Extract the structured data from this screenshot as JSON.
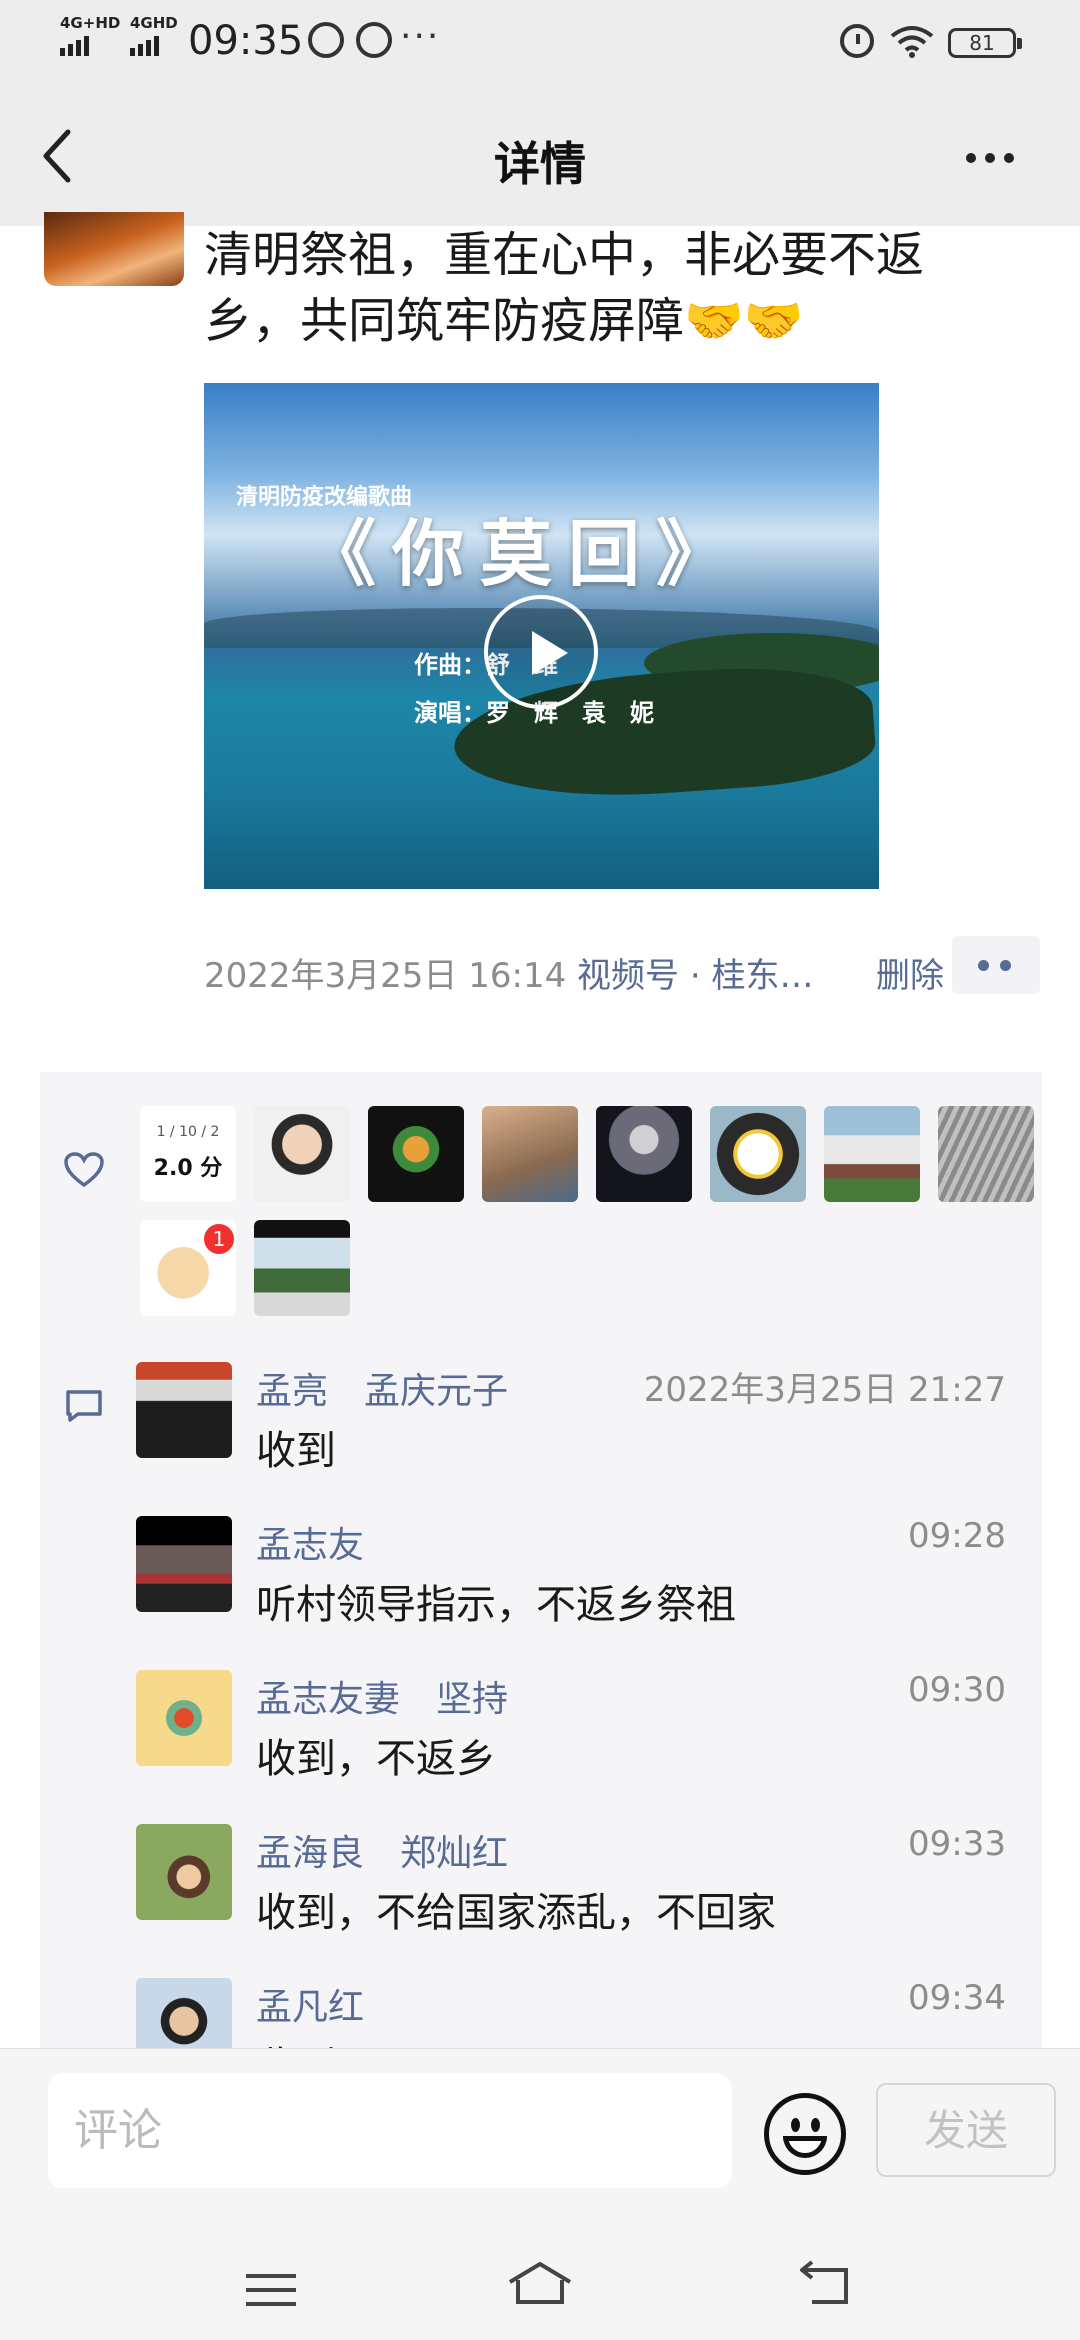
{
  "status_bar": {
    "network_1": "4G+HD",
    "network_2": "4GHD",
    "time": "09:35",
    "more": "···",
    "battery": "81"
  },
  "header": {
    "title": "详情"
  },
  "post": {
    "text": "清明祭祖，重在心中，非必要不返乡，共同筑牢防疫屏障🤝🤝",
    "video": {
      "subtitle": "清明防疫改编歌曲",
      "title": "《你莫回》",
      "credit_composer": "作曲：舒　维",
      "credit_singers": "演唱：罗　辉　袁　妮"
    },
    "date_time": "2022年3月25日 16:14",
    "source": "视频号 · 桂东…",
    "delete_label": "删除"
  },
  "likes": {
    "score_badge_line1": "1 / 10 / 2",
    "score_badge_line2": "2.0 分",
    "notification_count": "1"
  },
  "comments": [
    {
      "names": "孟亮　孟庆元子",
      "time": "2022年3月25日 21:27",
      "text": "收到"
    },
    {
      "names": "孟志友",
      "time": "09:28",
      "text": "听村领导指示，不返乡祭祖"
    },
    {
      "names": "孟志友妻　坚持",
      "time": "09:30",
      "text": "收到，不返乡"
    },
    {
      "names": "孟海良　郑灿红",
      "time": "09:33",
      "text": "收到，不给国家添乱，不回家"
    },
    {
      "names": "孟凡红",
      "time": "09:34",
      "text": "收到"
    }
  ],
  "input": {
    "placeholder": "评论",
    "send_label": "发送"
  },
  "colors": {
    "link_blue": "#576b95",
    "header_bg": "#ededed",
    "panel_bg": "#f5f5f7",
    "badge_red": "#f23030"
  },
  "icons": [
    "back-icon",
    "more-icon",
    "play-icon",
    "heart-icon",
    "comment-icon",
    "emoji-icon",
    "menu-icon",
    "home-icon",
    "return-icon"
  ]
}
